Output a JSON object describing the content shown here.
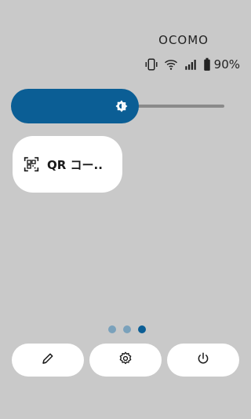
{
  "status_bar": {
    "carrier": "OCOMO",
    "battery_percent": "90%",
    "icons": [
      "vibrate-icon",
      "wifi-icon",
      "signal-icon",
      "battery-icon"
    ]
  },
  "brightness": {
    "level": 0.6,
    "icon": "brightness-auto-icon",
    "fill_color": "#0b5e95"
  },
  "tiles": [
    {
      "label": "QR コー..",
      "icon": "qr-code-scanner-icon"
    }
  ],
  "pager": {
    "count": 3,
    "active_index": 2
  },
  "bottom_actions": [
    {
      "icon": "edit-icon"
    },
    {
      "icon": "settings-icon"
    },
    {
      "icon": "power-icon"
    }
  ]
}
